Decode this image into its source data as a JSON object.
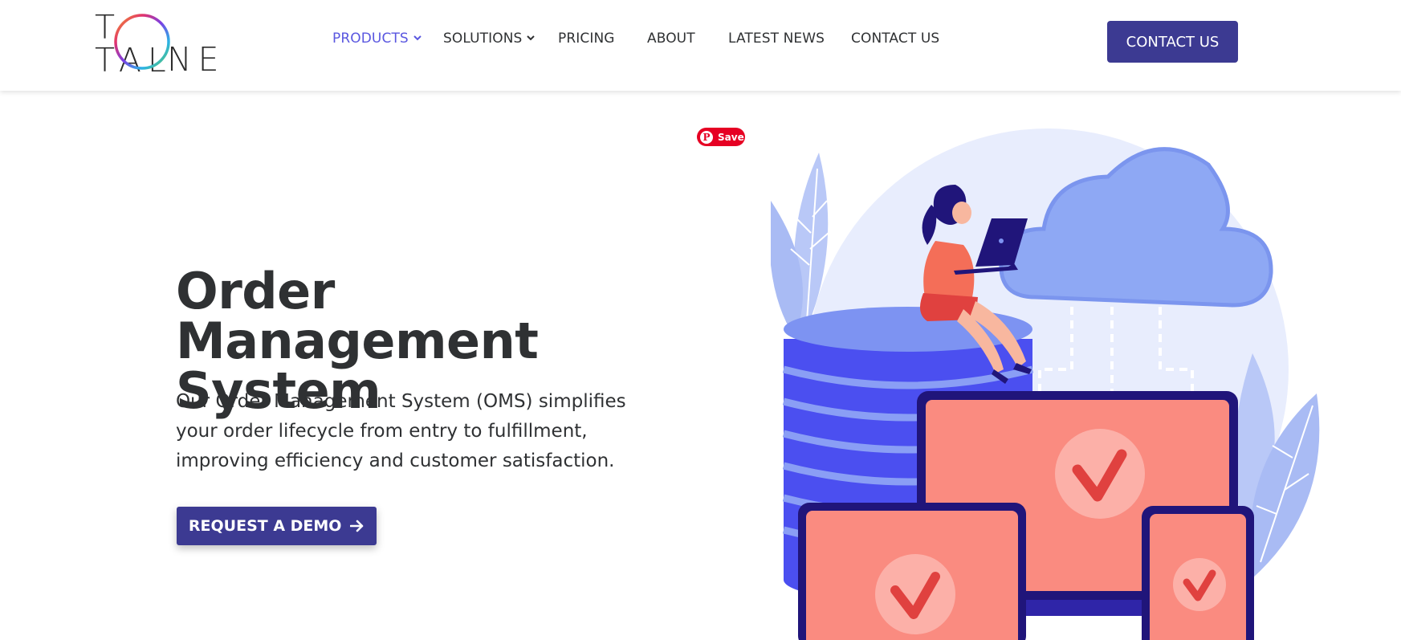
{
  "header": {
    "logo": {
      "line1": "T  TAL",
      "line2": "NE"
    },
    "nav": [
      {
        "label": "PRODUCTS",
        "has_dropdown": true,
        "active": true
      },
      {
        "label": "SOLUTIONS",
        "has_dropdown": true,
        "active": false
      },
      {
        "label": "PRICING",
        "has_dropdown": false,
        "active": false
      },
      {
        "label": "ABOUT",
        "has_dropdown": false,
        "active": false
      },
      {
        "label": "LATEST NEWS",
        "has_dropdown": false,
        "active": false
      },
      {
        "label": "CONTACT US",
        "has_dropdown": false,
        "active": false
      }
    ],
    "cta_label": "CONTACT US"
  },
  "pinterest": {
    "label": "Save"
  },
  "hero": {
    "title": "Order Management System",
    "description": "Our Order Management System (OMS) simplifies your order lifecycle from entry to fulfillment, improving efficiency and customer satisfaction.",
    "cta_label": "REQUEST A DEMO",
    "cta_icon": "arrow-right-icon"
  },
  "colors": {
    "brand": "#3c3a92",
    "nav_active": "#5a57e0",
    "pinterest": "#e60023",
    "device_salmon": "#fa8b80",
    "database_blue": "#4b4ff0",
    "cloud_blue": "#8ea8f4"
  }
}
